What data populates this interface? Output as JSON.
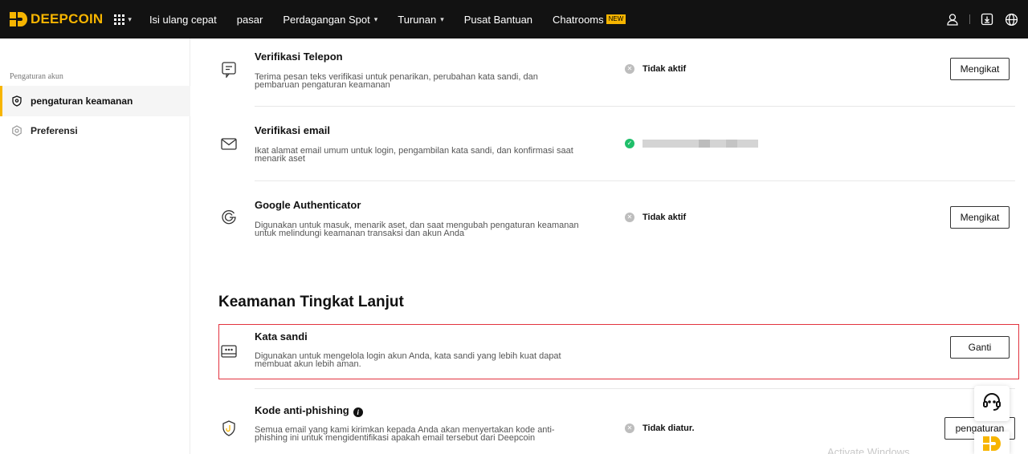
{
  "brand": {
    "name": "DEEPCOIN",
    "color": "#f7b500"
  },
  "nav": {
    "items": [
      {
        "label": "Isi ulang cepat",
        "has_caret": false
      },
      {
        "label": "pasar",
        "has_caret": false
      },
      {
        "label": "Perdagangan Spot",
        "has_caret": true
      },
      {
        "label": "Turunan",
        "has_caret": true
      },
      {
        "label": "Pusat Bantuan",
        "has_caret": false
      },
      {
        "label": "Chatrooms",
        "has_caret": false,
        "badge": "NEW"
      }
    ],
    "right_icons": [
      "user-icon",
      "download-icon",
      "globe-icon"
    ]
  },
  "sidebar": {
    "heading": "Pengaturan akun",
    "items": [
      {
        "label": "pengaturan keamanan",
        "icon": "shield-icon",
        "active": true
      },
      {
        "label": "Preferensi",
        "icon": "settings-hex-icon",
        "active": false
      }
    ]
  },
  "security": {
    "phone": {
      "title": "Verifikasi Telepon",
      "desc": "Terima pesan teks verifikasi untuk penarikan, perubahan kata sandi, dan pembaruan pengaturan keamanan",
      "status": "Tidak aktif",
      "button": "Mengikat",
      "icon": "phone-icon"
    },
    "email": {
      "title": "Verifikasi email",
      "desc": "Ikat alamat email umum untuk login, pengambilan kata sandi, dan konfirmasi saat menarik aset",
      "status_icon": "check-circle-icon",
      "icon": "mail-icon"
    },
    "google": {
      "title": "Google Authenticator",
      "desc": "Digunakan untuk masuk, menarik aset, dan saat mengubah pengaturan keamanan untuk melindungi keamanan transaksi dan akun Anda",
      "status": "Tidak aktif",
      "button": "Mengikat",
      "icon": "google-g-icon"
    }
  },
  "advanced": {
    "section_title": "Keamanan Tingkat Lanjut",
    "password": {
      "title": "Kata sandi",
      "desc": "Digunakan untuk mengelola login akun Anda, kata sandi yang lebih kuat dapat membuat akun lebih aman.",
      "button": "Ganti",
      "icon": "password-icon"
    },
    "antiphishing": {
      "title": "Kode anti-phishing",
      "desc": "Semua email yang kami kirimkan kepada Anda akan menyertakan kode anti-phishing ini untuk mengidentifikasi apakah email tersebut dari Deepcoin",
      "status": "Tidak diatur.",
      "button": "pengaturan",
      "icon": "shield-hook-icon"
    }
  },
  "colors": {
    "topbar": "#121212",
    "accent": "#f7b500",
    "highlight_border": "#e2333f",
    "ok": "#1fbf6a"
  },
  "watermark": "Activate Windows"
}
